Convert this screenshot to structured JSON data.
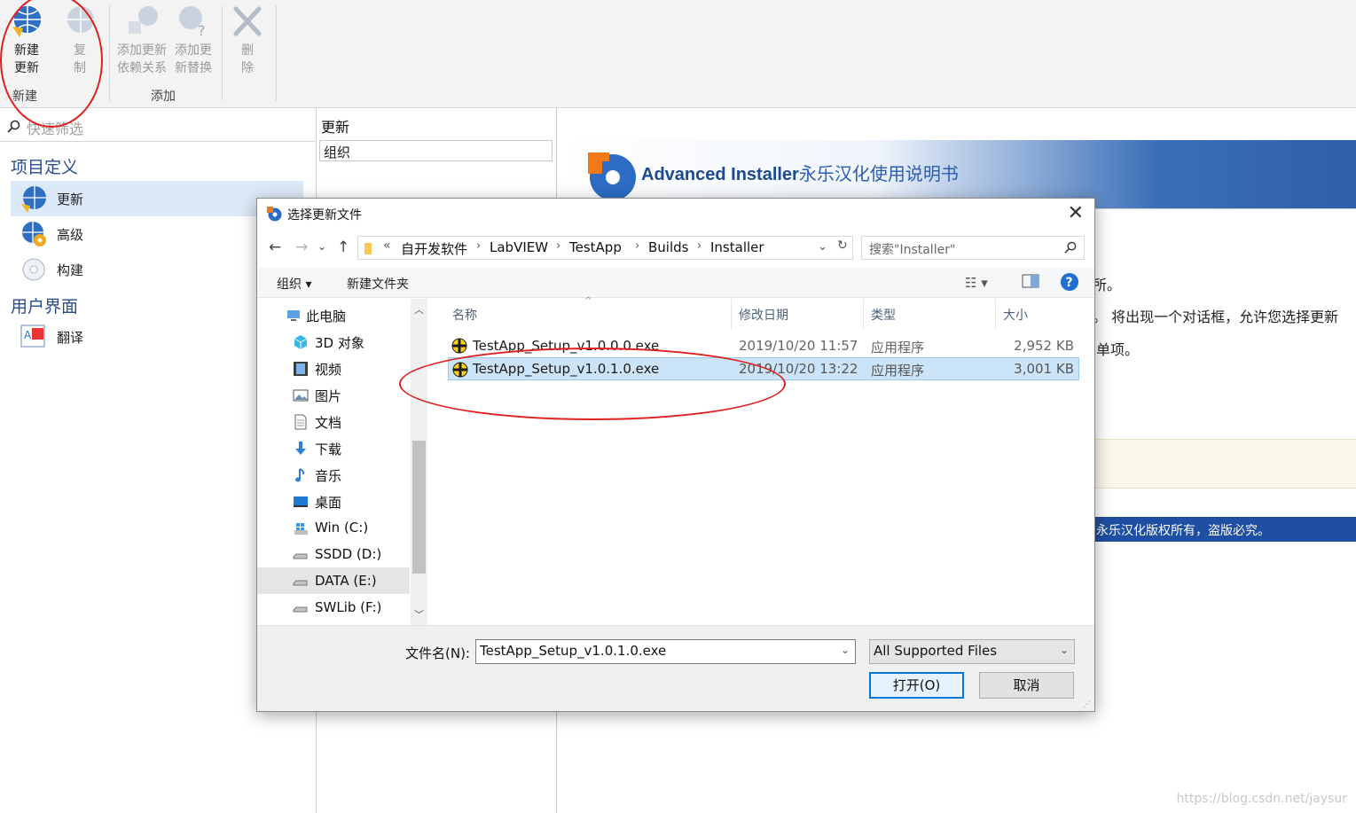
{
  "ribbon": {
    "buttons": {
      "new_update": [
        "新建",
        "更新"
      ],
      "copy": [
        "复",
        "制"
      ],
      "add_dependency": [
        "添加更新",
        "依赖关系"
      ],
      "add_replacement": [
        "添加更",
        "新替换"
      ],
      "delete": [
        "删",
        "除"
      ]
    },
    "groups": {
      "new": "新建",
      "add": "添加"
    }
  },
  "left_panel": {
    "search_placeholder": "快速筛选",
    "sections": {
      "project": "项目定义",
      "ui": "用户界面"
    },
    "items": {
      "updates": "更新",
      "advanced": "高级",
      "build": "构建",
      "translate": "翻译"
    }
  },
  "middle_panel": {
    "header": "更新",
    "organize": "组织"
  },
  "content": {
    "banner_title": "Advanced Installer",
    "banner_subtitle": "永乐汉化使用说明书",
    "partial_text_1": "所。",
    "partial_text_2": "。 将出现一个对话框，允许您选择更新",
    "partial_text_3": "单项。",
    "footer": "永乐汉化版权所有，盗版必究。",
    "watermark": "https://blog.csdn.net/jaysur"
  },
  "dialog": {
    "title": "选择更新文件",
    "breadcrumb": [
      "自开发软件",
      "LabVIEW",
      "TestApp",
      "Builds",
      "Installer"
    ],
    "breadcrumb_overflow": "«",
    "search_placeholder": "搜索\"Installer\"",
    "toolbar": {
      "organize": "组织",
      "new_folder": "新建文件夹"
    },
    "tree": [
      {
        "label": "此电脑",
        "icon": "computer-icon"
      },
      {
        "label": "3D 对象",
        "icon": "cube-icon"
      },
      {
        "label": "视频",
        "icon": "video-icon"
      },
      {
        "label": "图片",
        "icon": "picture-icon"
      },
      {
        "label": "文档",
        "icon": "document-icon"
      },
      {
        "label": "下载",
        "icon": "download-icon"
      },
      {
        "label": "音乐",
        "icon": "music-icon"
      },
      {
        "label": "桌面",
        "icon": "desktop-icon"
      },
      {
        "label": "Win (C:)",
        "icon": "windows-drive-icon"
      },
      {
        "label": "SSDD (D:)",
        "icon": "drive-icon"
      },
      {
        "label": "DATA (E:)",
        "icon": "drive-icon"
      },
      {
        "label": "SWLib (F:)",
        "icon": "drive-icon"
      }
    ],
    "columns": {
      "name": "名称",
      "date": "修改日期",
      "type": "类型",
      "size": "大小"
    },
    "files": [
      {
        "name": "TestApp_Setup_v1.0.0.0.exe",
        "date": "2019/10/20 11:57",
        "type": "应用程序",
        "size": "2,952 KB"
      },
      {
        "name": "TestApp_Setup_v1.0.1.0.exe",
        "date": "2019/10/20 13:22",
        "type": "应用程序",
        "size": "3,001 KB"
      }
    ],
    "filename_label": "文件名(N):",
    "filename_value": "TestApp_Setup_v1.0.1.0.exe",
    "filetype_value": "All Supported Files",
    "open_button": "打开(O)",
    "cancel_button": "取消"
  }
}
